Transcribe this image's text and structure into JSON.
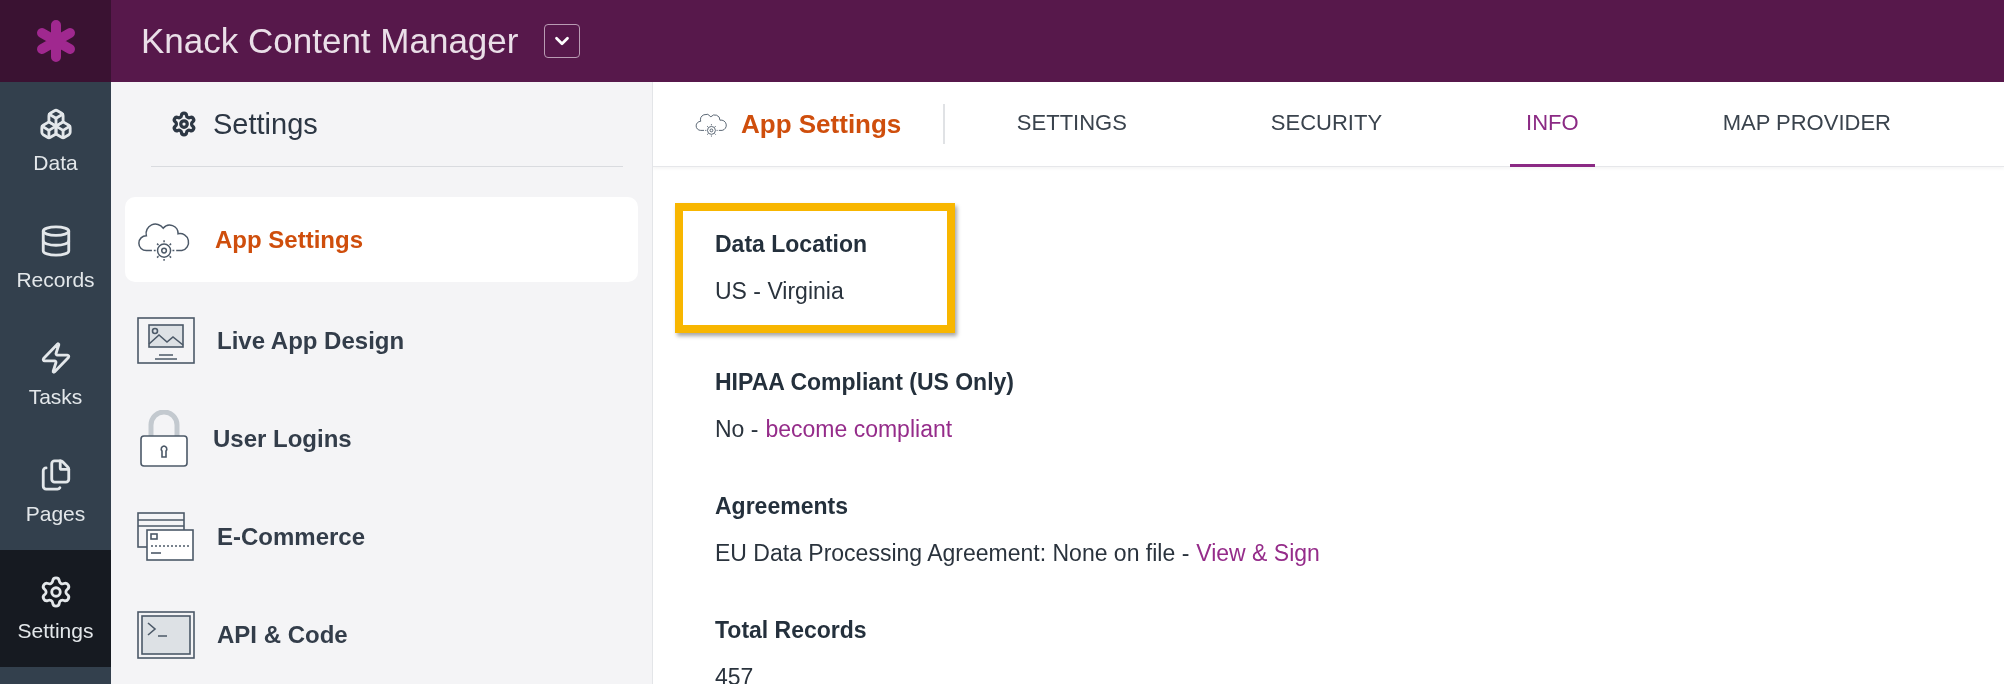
{
  "header": {
    "title": "Knack Content Manager"
  },
  "rail": [
    {
      "label": "Data",
      "selected": false
    },
    {
      "label": "Records",
      "selected": false
    },
    {
      "label": "Tasks",
      "selected": false
    },
    {
      "label": "Pages",
      "selected": false
    },
    {
      "label": "Settings",
      "selected": true
    }
  ],
  "settings_panel": {
    "title": "Settings",
    "items": [
      {
        "label": "App Settings",
        "selected": true
      },
      {
        "label": "Live App Design",
        "selected": false
      },
      {
        "label": "User Logins",
        "selected": false
      },
      {
        "label": "E-Commerce",
        "selected": false
      },
      {
        "label": "API & Code",
        "selected": false
      }
    ]
  },
  "page_title": "App Settings",
  "tabs": [
    {
      "label": "SETTINGS",
      "selected": false
    },
    {
      "label": "SECURITY",
      "selected": false
    },
    {
      "label": "INFO",
      "selected": true
    },
    {
      "label": "MAP PROVIDER",
      "selected": false
    }
  ],
  "info": [
    {
      "heading": "Data Location",
      "value": "US - Virginia",
      "highlighted": true
    },
    {
      "heading": "HIPAA Compliant (US Only)",
      "value": "No -",
      "link": "become compliant",
      "highlighted": false
    },
    {
      "heading": "Agreements",
      "value": "EU Data Processing Agreement: None on file -",
      "link": "View & Sign",
      "highlighted": false
    },
    {
      "heading": "Total Records",
      "value": "457",
      "highlighted": false
    }
  ]
}
